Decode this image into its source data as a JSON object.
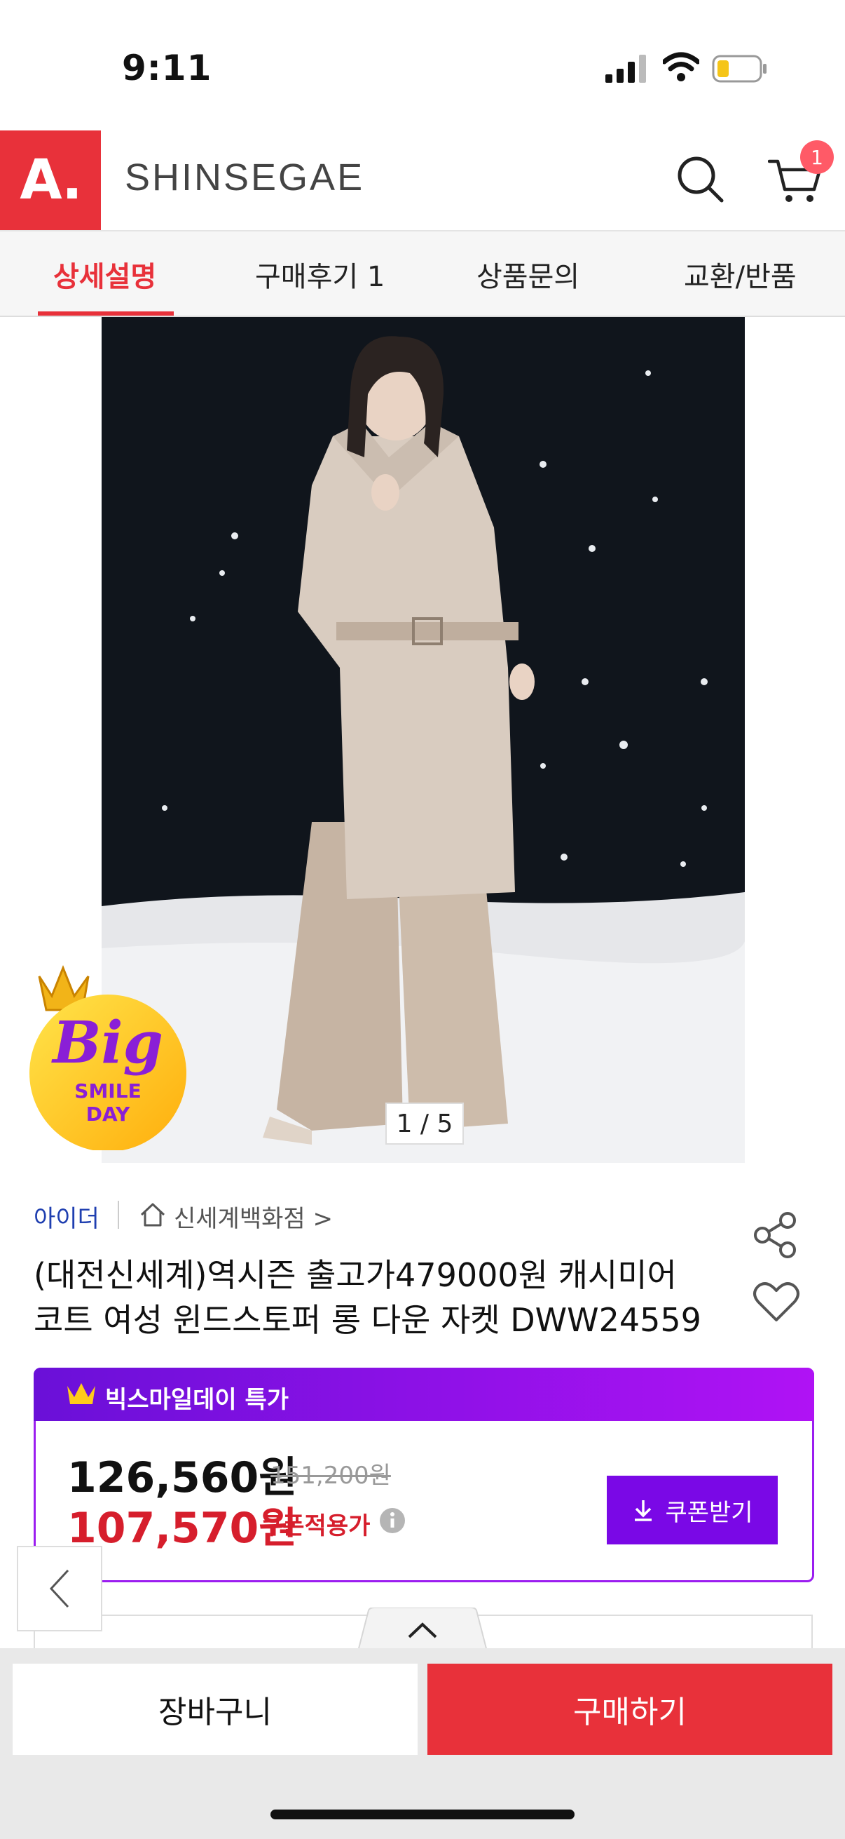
{
  "status": {
    "time": "9:11"
  },
  "header": {
    "logo": "A.",
    "brand": "SHINSEGAE",
    "cart_count": "1"
  },
  "tabs": [
    {
      "label": "상세설명",
      "active": true
    },
    {
      "label": "구매후기 1",
      "active": false
    },
    {
      "label": "상품문의",
      "active": false
    },
    {
      "label": "교환/반품",
      "active": false
    }
  ],
  "gallery": {
    "counter": "1 / 5"
  },
  "badge": {
    "line1": "Big",
    "line2": "SMILE",
    "line3": "DAY"
  },
  "product": {
    "seller": "아이더",
    "store": "신세계백화점 >",
    "title_line1": "(대전신세계)역시즌 출고가479000원 캐시미어",
    "title_line2": "코트 여성 윈드스토퍼 롱 다운 자켓 DWW24559"
  },
  "promo": {
    "label": "빅스마일데이 특가",
    "price": "126,560원",
    "original_price": "151,200원",
    "coupon_price": "107,570원",
    "coupon_label": "쿠폰적용가",
    "coupon_button": "쿠폰받기"
  },
  "bottom": {
    "cart_button": "장바구니",
    "buy_button": "구매하기"
  },
  "colors": {
    "accent": "#e8313a",
    "promo_purple": "#7a08e6",
    "seller_blue": "#1f3fb0"
  }
}
